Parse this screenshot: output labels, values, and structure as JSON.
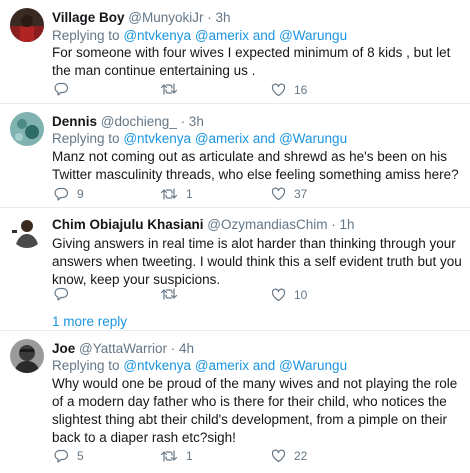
{
  "tweets": [
    {
      "name": "Village Boy",
      "handle": "@MunyokiJr",
      "time": "· 3h",
      "replying_prefix": "Replying to",
      "mention1": "@ntvkenya",
      "mention_sep": "@amerix and",
      "mention2": "@Warungu",
      "text": "For someone with four wives I expected minimum of 8 kids , but let the man continue entertaining us .",
      "reply_count": "",
      "retweet_count": "",
      "like_count": "16",
      "avatar_color": "#7a1a1a"
    },
    {
      "name": "Dennis",
      "handle": "@dochieng_",
      "time": "· 3h",
      "replying_prefix": "Replying to",
      "mention1": "@ntvkenya",
      "mention_sep": "@amerix and",
      "mention2": "@Warungu",
      "text": "Manz not coming out as articulate and shrewd as he's been on his Twitter masculinity threads, who else feeling something amiss here?",
      "reply_count": "9",
      "retweet_count": "1",
      "like_count": "37",
      "avatar_color": "#3f7a73"
    },
    {
      "name": "Chim Obiajulu Khasiani",
      "handle": "@OzymandiasChim",
      "time": "· 1h",
      "replying_prefix": "",
      "mention1": "",
      "mention_sep": "",
      "mention2": "",
      "text": "Giving answers in real time is alot harder than thinking through your answers when tweeting. I would think this a self evident truth but you know, keep your suspicions.",
      "reply_count": "",
      "retweet_count": "",
      "like_count": "10",
      "avatar_color": "#5a4a3e"
    },
    {
      "name": "Joe",
      "handle": "@YattaWarrior",
      "time": "· 4h",
      "replying_prefix": "Replying to",
      "mention1": "@ntvkenya",
      "mention_sep": "@amerix and",
      "mention2": "@Warungu",
      "text": "Why would one be proud of the many wives and not playing the role of a modern day father who is there for their child, who notices the slightest thing abt their child's development, from a pimple on their back to a diaper rash etc?sigh!",
      "reply_count": "5",
      "retweet_count": "1",
      "like_count": "22",
      "avatar_color": "#6b6b6b"
    }
  ],
  "more_replies": "1 more reply",
  "colors": {
    "link": "#1b95e0",
    "muted": "#657786",
    "text": "#14171a",
    "divider": "#e6ecf0"
  },
  "icons": {
    "reply": "reply-icon",
    "retweet": "retweet-icon",
    "like": "heart-icon"
  }
}
